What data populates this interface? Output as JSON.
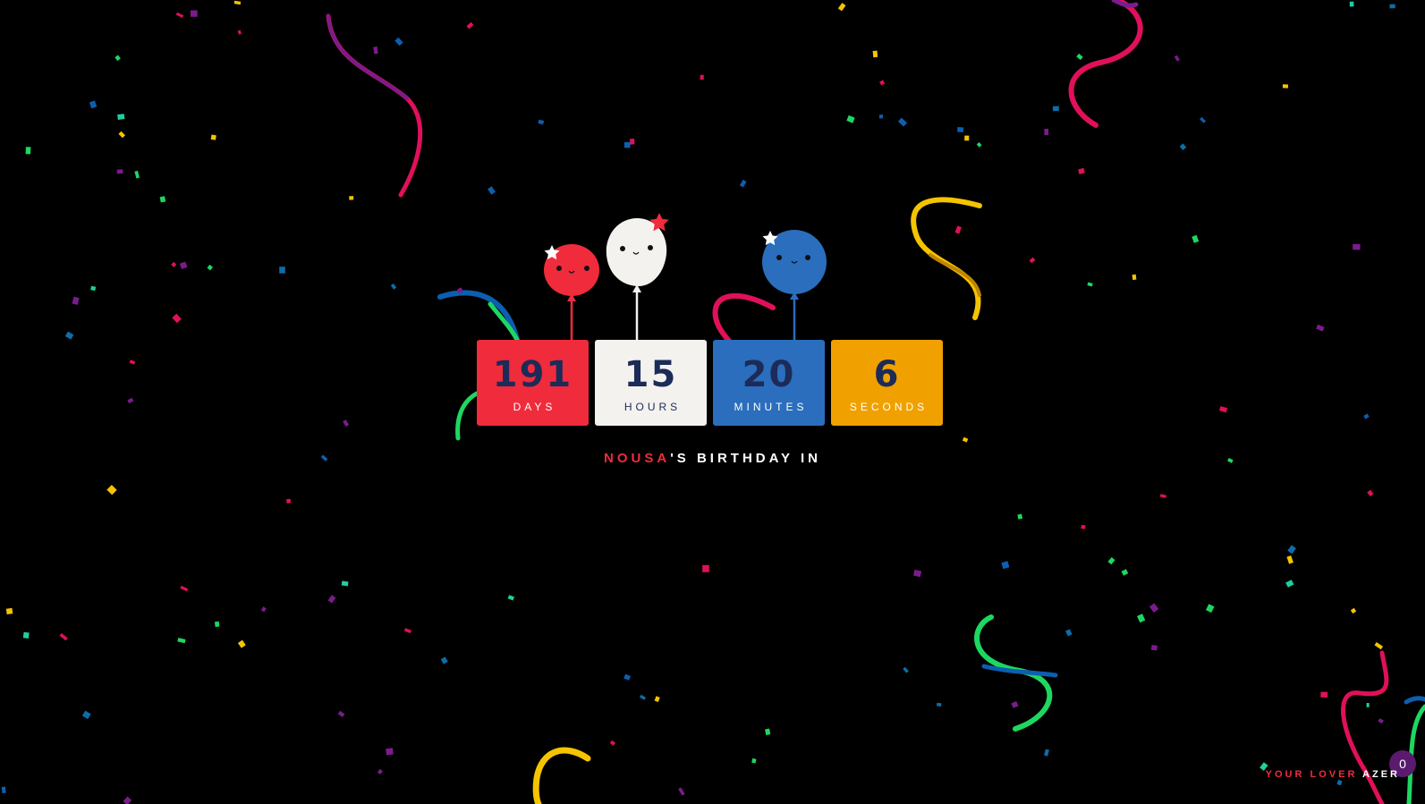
{
  "headline": {
    "name": "NOUSA",
    "rest": "'S BIRTHDAY IN"
  },
  "countdown": [
    {
      "value": "191",
      "unit": "DAYS"
    },
    {
      "value": "15",
      "unit": "HOURS"
    },
    {
      "value": "20",
      "unit": "MINUTES"
    },
    {
      "value": "6",
      "unit": "SECONDS"
    }
  ],
  "footer": {
    "lover_label": "YOUR LOVER",
    "author": "AZER"
  },
  "badge": {
    "count": "0"
  },
  "colors": {
    "background": "#000000",
    "red": "#f02b3c",
    "white": "#f3f2ef",
    "blue": "#2a6ebd",
    "orange": "#f0a100",
    "navy": "#1c2b57",
    "badge_purple": "#5a1a6e"
  },
  "balloons": [
    {
      "color": "red",
      "icon": "star-icon"
    },
    {
      "color": "white",
      "icon": "star-icon"
    },
    {
      "color": "blue",
      "icon": "star-icon"
    }
  ]
}
